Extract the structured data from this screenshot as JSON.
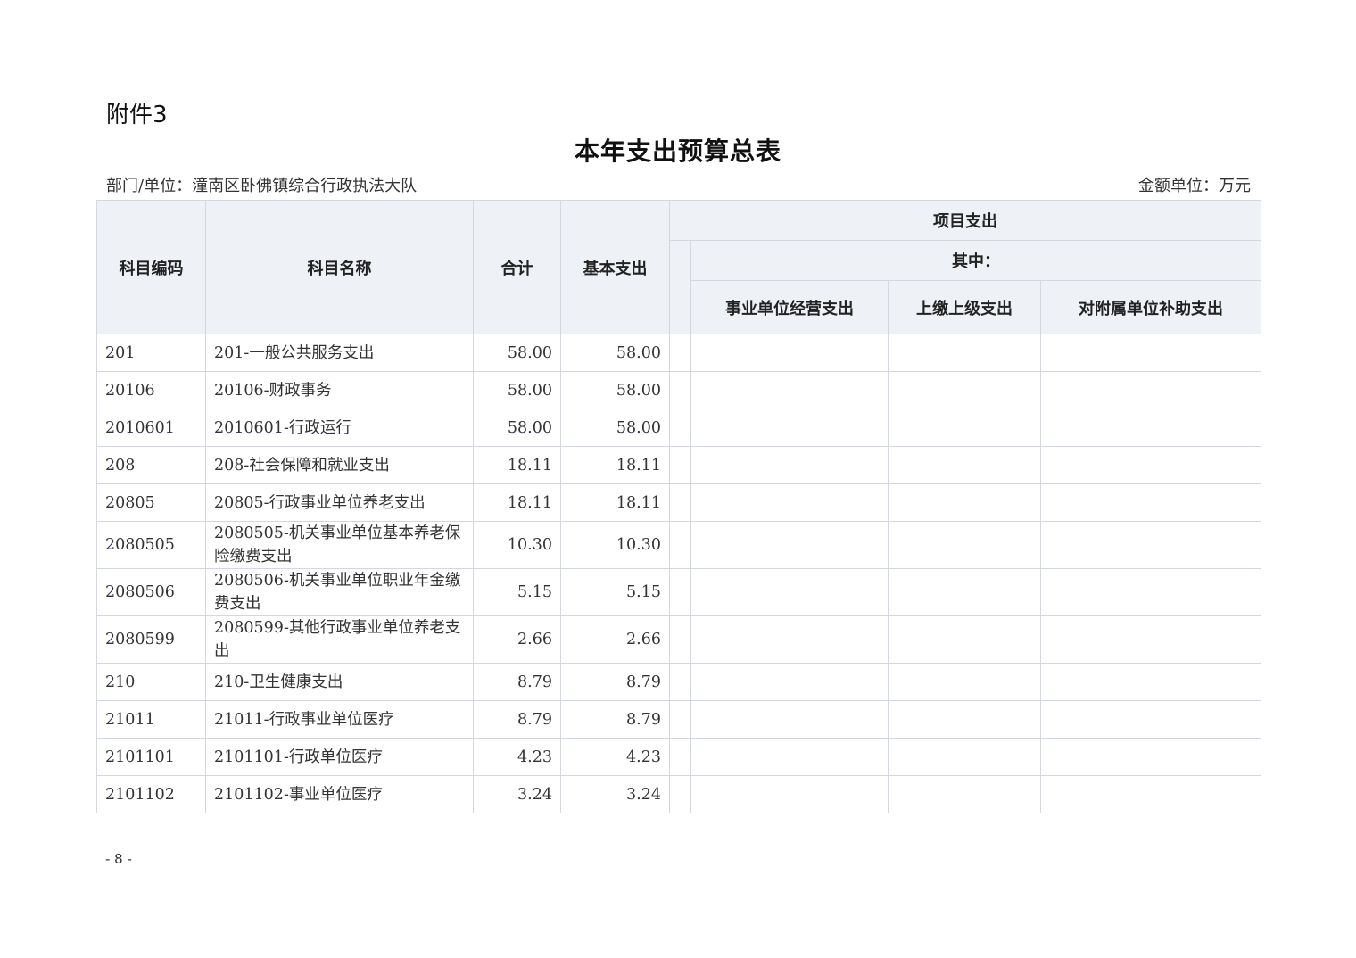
{
  "attachment_label": "附件3",
  "title": "本年支出预算总表",
  "department_label": "部门/单位：潼南区卧佛镇综合行政执法大队",
  "unit_label": "金额单位：万元",
  "headers": {
    "code": "科目编码",
    "name": "科目名称",
    "total": "合计",
    "basic": "基本支出",
    "project": "项目支出",
    "among": "其中：",
    "business": "事业单位经营支出",
    "upper": "上缴上级支出",
    "subsidy": "对附属单位补助支出"
  },
  "rows": [
    {
      "code": "201",
      "name": "201-一般公共服务支出",
      "total": "58.00",
      "basic": "58.00"
    },
    {
      "code": "20106",
      "name": "20106-财政事务",
      "total": "58.00",
      "basic": "58.00"
    },
    {
      "code": "2010601",
      "name": "2010601-行政运行",
      "total": "58.00",
      "basic": "58.00"
    },
    {
      "code": "208",
      "name": "208-社会保障和就业支出",
      "total": "18.11",
      "basic": "18.11"
    },
    {
      "code": "20805",
      "name": "20805-行政事业单位养老支出",
      "total": "18.11",
      "basic": "18.11"
    },
    {
      "code": "2080505",
      "name": "2080505-机关事业单位基本养老保险缴费支出",
      "total": "10.30",
      "basic": "10.30"
    },
    {
      "code": "2080506",
      "name": "2080506-机关事业单位职业年金缴费支出",
      "total": "5.15",
      "basic": "5.15"
    },
    {
      "code": "2080599",
      "name": "2080599-其他行政事业单位养老支出",
      "total": "2.66",
      "basic": "2.66"
    },
    {
      "code": "210",
      "name": "210-卫生健康支出",
      "total": "8.79",
      "basic": "8.79"
    },
    {
      "code": "21011",
      "name": "21011-行政事业单位医疗",
      "total": "8.79",
      "basic": "8.79"
    },
    {
      "code": "2101101",
      "name": "2101101-行政单位医疗",
      "total": "4.23",
      "basic": "4.23"
    },
    {
      "code": "2101102",
      "name": "2101102-事业单位医疗",
      "total": "3.24",
      "basic": "3.24"
    }
  ],
  "page_number": "- 8 -"
}
